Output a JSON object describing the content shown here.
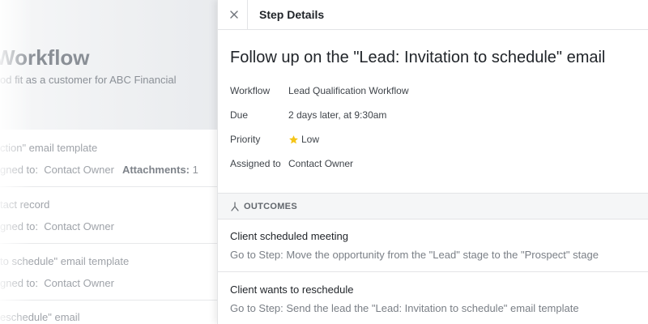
{
  "background": {
    "title": "Workflow",
    "subtitle": "od fit as a customer for ABC Financial",
    "items": [
      {
        "line1": "ction\" email template",
        "assigned_prefix": "gned to:",
        "assigned_value": "Contact Owner",
        "attachments_label": "Attachments:",
        "attachments_value": "1"
      },
      {
        "line1": "tact record",
        "assigned_prefix": "gned to:",
        "assigned_value": "Contact Owner"
      },
      {
        "line1": "to schedule\" email template",
        "assigned_prefix": "gned to:",
        "assigned_value": "Contact Owner"
      },
      {
        "line1": "eschedule\" email"
      }
    ]
  },
  "drawer": {
    "close_icon": "close-icon",
    "header_title": "Step Details",
    "step_title": "Follow up on the \"Lead: Invitation to schedule\" email",
    "details": {
      "workflow_label": "Workflow",
      "workflow_value": "Lead Qualification Workflow",
      "due_label": "Due",
      "due_value": "2 days later, at 9:30am",
      "priority_label": "Priority",
      "priority_value": "Low",
      "priority_icon": "star-icon",
      "priority_color": "#f5c518",
      "assigned_label": "Assigned to",
      "assigned_value": "Contact Owner"
    },
    "outcomes": {
      "icon": "branch-icon",
      "label": "OUTCOMES",
      "items": [
        {
          "title": "Client scheduled meeting",
          "description": "Go to Step: Move the opportunity from the \"Lead\" stage to the \"Prospect\" stage"
        },
        {
          "title": "Client wants to reschedule",
          "description": "Go to Step: Send the lead the \"Lead: Invitation to schedule\" email template"
        }
      ]
    }
  }
}
